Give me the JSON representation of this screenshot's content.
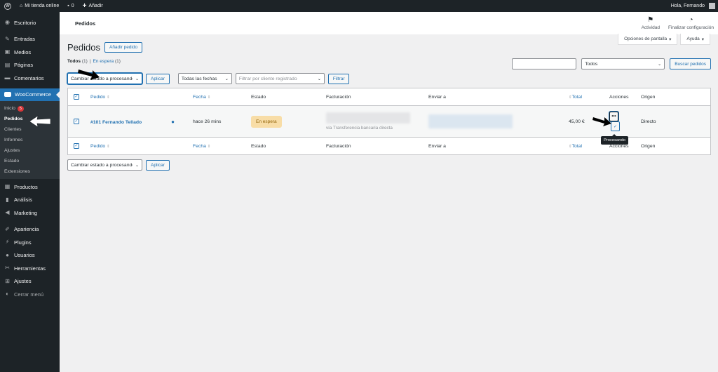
{
  "adminbar": {
    "site_name": "Mi tienda online",
    "comments_count": "0",
    "new_label": "Añadir",
    "greeting": "Hola, Fernando"
  },
  "sidebar": {
    "items": [
      {
        "label": "Escritorio",
        "icon": "dashboard-icon"
      },
      {
        "label": "Entradas",
        "icon": "pin-icon"
      },
      {
        "label": "Medios",
        "icon": "media-icon"
      },
      {
        "label": "Páginas",
        "icon": "page-icon"
      },
      {
        "label": "Comentarios",
        "icon": "comment-icon"
      },
      {
        "label": "WooCommerce",
        "icon": "woo-icon"
      }
    ],
    "woo_sub": {
      "inicio": "Inicio",
      "inicio_badge": "5",
      "pedidos": "Pedidos",
      "clientes": "Clientes",
      "informes": "Informes",
      "ajustes": "Ajustes",
      "estado": "Estado",
      "extensiones": "Extensiones"
    },
    "items2": [
      {
        "label": "Productos",
        "icon": "products-icon"
      },
      {
        "label": "Análisis",
        "icon": "analytics-icon"
      },
      {
        "label": "Marketing",
        "icon": "megaphone-icon"
      },
      {
        "label": "Apariencia",
        "icon": "brush-icon"
      },
      {
        "label": "Plugins",
        "icon": "plugin-icon"
      },
      {
        "label": "Usuarios",
        "icon": "users-icon"
      },
      {
        "label": "Herramientas",
        "icon": "wrench-icon"
      },
      {
        "label": "Ajustes",
        "icon": "settings-icon"
      },
      {
        "label": "Cerrar menú",
        "icon": "collapse-icon"
      }
    ]
  },
  "header": {
    "title": "Pedidos",
    "actividad": "Actividad",
    "finalizar": "Finalizar configuración"
  },
  "screen_meta": {
    "options": "Opciones de pantalla",
    "help": "Ayuda"
  },
  "page": {
    "title": "Pedidos",
    "add_button": "Añadir pedido",
    "filter_all": "Todos",
    "filter_all_count": "(1)",
    "filter_hold": "En espera",
    "filter_hold_count": "(1)",
    "bulk_action": "Cambiar estado a procesando",
    "apply": "Aplicar",
    "date_filter": "Todas las fechas",
    "customer_filter_placeholder": "Filtrar por cliente registrado",
    "filter_button": "Filtrar",
    "search_type": "Todos",
    "search_button": "Buscar pedidos"
  },
  "table": {
    "columns": {
      "pedido": "Pedido",
      "fecha": "Fecha",
      "estado": "Estado",
      "facturacion": "Facturación",
      "enviar_a": "Enviar a",
      "total": "Total",
      "acciones": "Acciones",
      "origen": "Origen"
    },
    "rows": [
      {
        "order": "#101 Fernando Tellado",
        "date": "hace 26 mins",
        "status": "En espera",
        "billing_via": "vía Transferencia bancaria directa",
        "total": "45,00 €",
        "origin": "Directo"
      }
    ],
    "tooltip": "Procesando"
  },
  "colors": {
    "accent": "#2271b1",
    "adminbar": "#1d2327",
    "status_hold_bg": "#f8dda7",
    "status_hold_text": "#94660c"
  }
}
